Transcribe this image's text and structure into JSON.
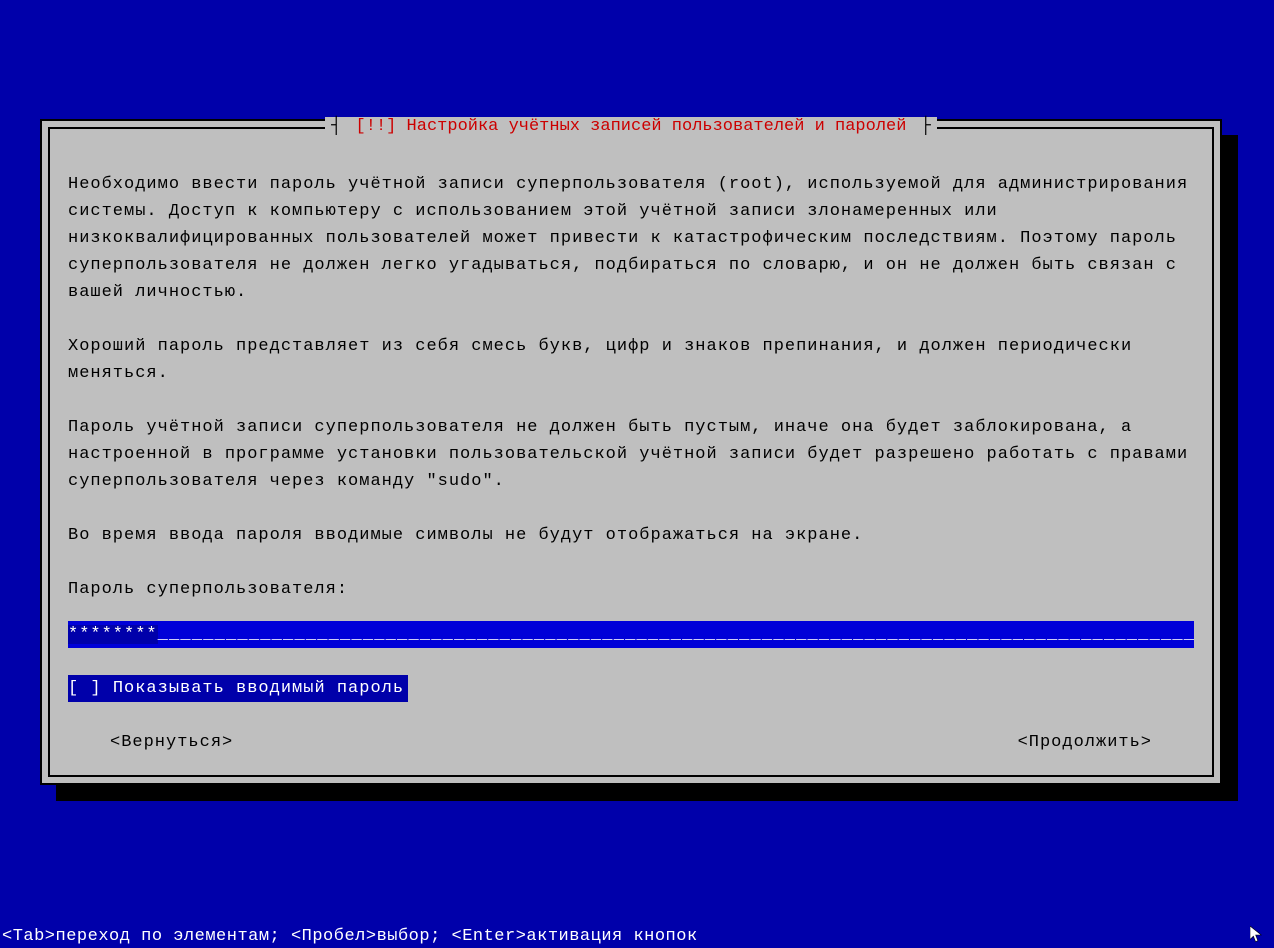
{
  "dialog": {
    "title_prefix": "┤",
    "title": "[!!] Настройка учётных записей пользователей и паролей",
    "title_suffix": "├",
    "paragraph1": "Необходимо ввести пароль учётной записи суперпользователя (root), используемой для администрирования системы. Доступ к компьютеру с использованием этой учётной записи злонамеренных или низкоквалифицированных пользователей может привести к катастрофическим последствиям. Поэтому пароль суперпользователя не должен легко угадываться, подбираться по словарю, и он не должен быть связан с вашей личностью.",
    "paragraph2": "Хороший пароль представляет из себя смесь букв, цифр и знаков препинания, и должен периодически меняться.",
    "paragraph3": "Пароль учётной записи суперпользователя не должен быть пустым, иначе она будет заблокирована, а настроенной в программе установки пользовательской учётной записи будет разрешено работать с правами суперпользователя через команду \"sudo\".",
    "paragraph4": "Во время ввода пароля вводимые символы не будут отображаться на экране.",
    "prompt_label": "Пароль суперпользователя:",
    "password_value": "********",
    "password_fill": "___________________________________________________________________________________________",
    "checkbox_state": "[ ]",
    "checkbox_label": "Показывать вводимый пароль",
    "back_button": "<Вернуться>",
    "continue_button": "<Продолжить>"
  },
  "footer": {
    "tab_key": "<Tab>",
    "tab_text": "переход по элементам; ",
    "space_key": "<Пробел>",
    "space_text": "выбор; ",
    "enter_key": "<Enter>",
    "enter_text": "активация кнопок"
  }
}
